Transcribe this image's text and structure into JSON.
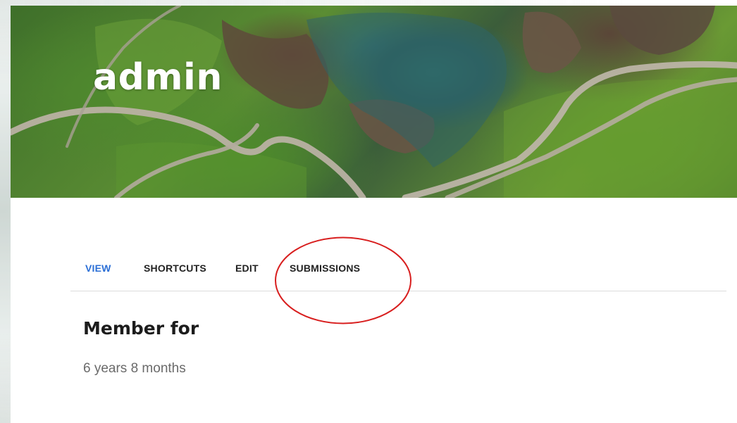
{
  "profile": {
    "username": "admin"
  },
  "tabs": [
    {
      "label": "VIEW",
      "active": true
    },
    {
      "label": "SHORTCUTS",
      "active": false
    },
    {
      "label": "EDIT",
      "active": false
    },
    {
      "label": "SUBMISSIONS",
      "active": false
    }
  ],
  "member": {
    "heading": "Member for",
    "duration": "6 years 8 months"
  },
  "colors": {
    "active_tab": "#2b6fd6",
    "annotation": "#d81e1e"
  },
  "annotation": {
    "highlighted_tab": "SUBMISSIONS"
  }
}
